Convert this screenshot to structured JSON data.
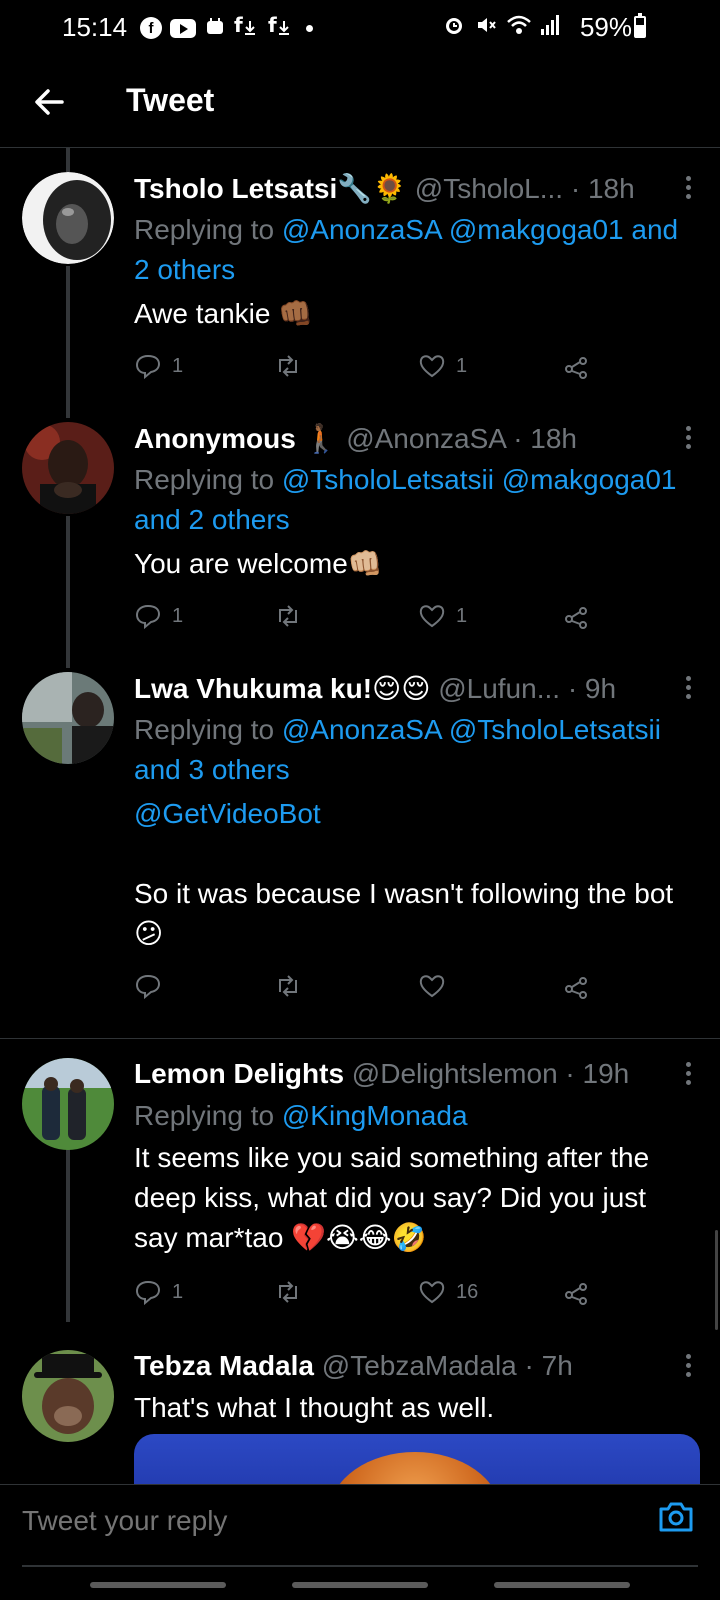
{
  "status_bar": {
    "time": "15:14",
    "battery": "59%",
    "left_icons": [
      "facebook-icon",
      "youtube-icon",
      "shopping-icon",
      "download-icon",
      "download-icon",
      "dot-icon"
    ],
    "right_icons": [
      "alarm-icon",
      "mute-icon",
      "wifi-icon",
      "signal-icon",
      "battery-icon"
    ]
  },
  "header": {
    "title": "Tweet",
    "back_icon": "arrow-left-icon"
  },
  "tweets": [
    {
      "name": "Tsholo Letsatsi🔧🌻",
      "handle": "@TsholoL...",
      "time": "· 18h",
      "replying_prefix": "Replying to ",
      "replying_mentions": "@AnonzaSA @makgoga01 and 2 others",
      "body": "Awe tankie 👊🏾",
      "replies": "1",
      "retweets": "",
      "likes": "1"
    },
    {
      "name": "Anonymous 🚶🏾",
      "handle": "@AnonzaSA",
      "time": "· 18h",
      "replying_prefix": "Replying to ",
      "replying_mentions": "@TsholoLetsatsii @makgoga01 and 2 others",
      "body": "You are welcome👊🏼",
      "replies": "1",
      "retweets": "",
      "likes": "1"
    },
    {
      "name": "Lwa Vhukuma ku!😌😌",
      "handle": "@Lufun...",
      "time": "· 9h",
      "replying_prefix": "Replying to ",
      "replying_mentions": "@AnonzaSA @TsholoLetsatsii and 3 others",
      "body_mention": "@GetVideoBot",
      "body": "So it was because I wasn't following the bot 😕",
      "replies": "",
      "retweets": "",
      "likes": ""
    },
    {
      "name": "Lemon Delights",
      "handle": "@Delightslemon",
      "time": "· 19h",
      "replying_prefix": "Replying to ",
      "replying_mentions": "@KingMonada",
      "body": "It seems like you said something after the deep kiss, what did you say? Did you just say mar*tao 💔😭😂🤣",
      "replies": "1",
      "retweets": "",
      "likes": "16"
    },
    {
      "name": "Tebza Madala",
      "handle": "@TebzaMadala",
      "time": "· 7h",
      "body": "That's what I thought as well."
    }
  ],
  "reply_bar": {
    "placeholder": "Tweet your reply",
    "camera_icon": "camera-icon"
  },
  "colors": {
    "background": "#000000",
    "text": "#ffffff",
    "secondary": "#71767b",
    "link": "#1d9bf0"
  }
}
